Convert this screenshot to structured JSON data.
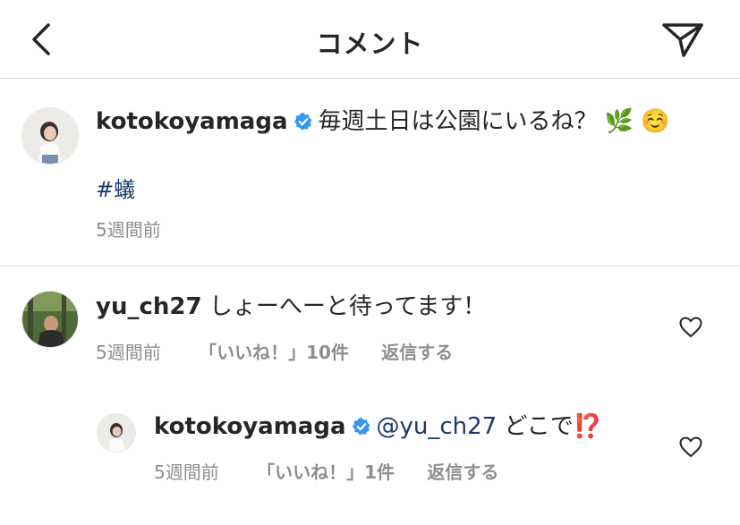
{
  "header": {
    "title": "コメント"
  },
  "caption": {
    "username": "kotokoyamaga",
    "text": "毎週土日は公園にいるね？",
    "emoji": "🌿 ☺️",
    "hashtag": "#蟻",
    "time": "5週間前"
  },
  "comments": [
    {
      "username": "yu_ch27",
      "text": "しょーへーと待ってます！",
      "time": "5週間前",
      "likes": "「いいね！」10件",
      "reply": "返信する"
    }
  ],
  "replies": [
    {
      "username": "kotokoyamaga",
      "mention": "@yu_ch27",
      "text": "どこで",
      "emoji": "⁉️",
      "time": "5週間前",
      "likes": "「いいね！」1件",
      "reply": "返信する"
    }
  ],
  "colors": {
    "verified": "#3897f0",
    "link": "#1a3a6d",
    "meta": "#8e8e8e",
    "divider": "#dbdbdb"
  },
  "icons": [
    "back-arrow-icon",
    "send-icon",
    "verified-badge-icon",
    "heart-icon"
  ]
}
